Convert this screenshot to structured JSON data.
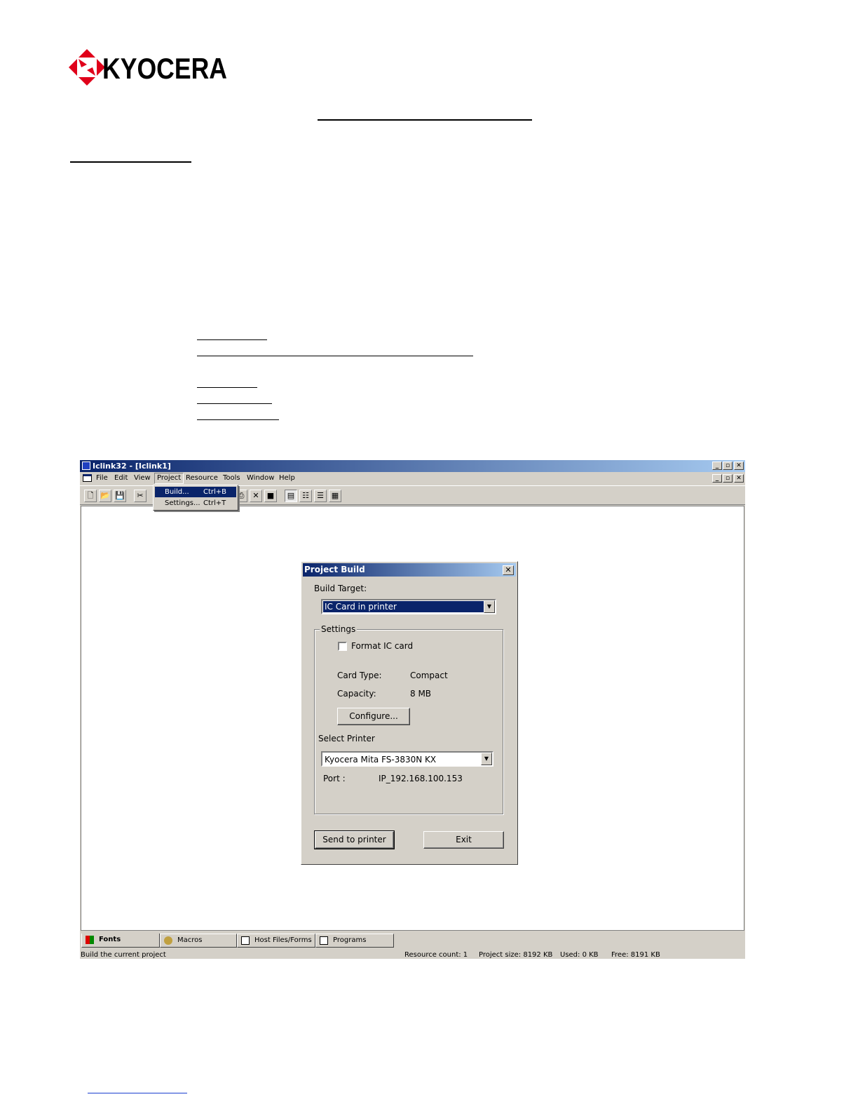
{
  "logo": {
    "text": "KYOCERA",
    "color": "#e0001a"
  },
  "window": {
    "title": "Iclink32 - [Iclink1]",
    "menu": [
      "File",
      "Edit",
      "View",
      "Project",
      "Resource",
      "Tools",
      "Window",
      "Help"
    ],
    "active_menu": "Project",
    "dropdown": [
      {
        "label": "Build...",
        "accel": "Ctrl+B"
      },
      {
        "label": "Settings...",
        "accel": "Ctrl+T"
      }
    ],
    "tabs": [
      "Fonts",
      "Macros",
      "Host Files/Forms",
      "Programs"
    ],
    "status": {
      "hint": "Build the current project",
      "resource_count": "Resource count: 1",
      "project_size": "Project size: 8192 KB",
      "used": "Used: 0 KB",
      "free": "Free: 8191 KB"
    }
  },
  "dialog": {
    "title": "Project Build",
    "build_target_label": "Build Target:",
    "build_target_value": "IC Card in printer",
    "settings_label": "Settings",
    "format_checkbox": "Format IC card",
    "card_type_label": "Card Type:",
    "card_type_value": "Compact",
    "capacity_label": "Capacity:",
    "capacity_value": "8 MB",
    "configure_button": "Configure...",
    "select_printer_label": "Select Printer",
    "printer_value": "Kyocera Mita FS-3830N KX",
    "port_label": "Port :",
    "port_value": "IP_192.168.100.153",
    "send_button": "Send to printer",
    "exit_button": "Exit"
  }
}
